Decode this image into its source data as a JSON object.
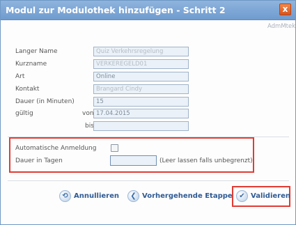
{
  "window": {
    "title": "Modul zur Modulothek hinzufügen - Schritt 2",
    "close_glyph": "x"
  },
  "header": {
    "user": "AdmMtek"
  },
  "form": {
    "langer_name": {
      "label": "Langer Name",
      "value": "Quiz Verkehrsregelung"
    },
    "kurzname": {
      "label": "Kurzname",
      "value": "VERKEREGELD01"
    },
    "art": {
      "label": "Art",
      "value": "Online"
    },
    "kontakt": {
      "label": "Kontakt",
      "value": "Brangard Cindy"
    },
    "dauer": {
      "label": "Dauer (in Minuten)",
      "value": "15"
    },
    "gueltig": {
      "label": "gültig",
      "von_label": "von",
      "von_value": "17.04.2015",
      "bis_label": "bis",
      "bis_value": ""
    }
  },
  "options": {
    "auto_anmeldung": {
      "label": "Automatische Anmeldung",
      "checked": false
    },
    "dauer_tagen": {
      "label": "Dauer in Tagen",
      "value": "",
      "hint": "(Leer lassen falls unbegrenzt)"
    }
  },
  "buttons": {
    "annullieren": "Annullieren",
    "vorhergehende": "Vorhergehende Etappe",
    "validieren": "Validieren"
  },
  "colors": {
    "title_bar": "#7aa5d6",
    "highlight": "#e13b34",
    "button_text": "#2f5a93"
  }
}
